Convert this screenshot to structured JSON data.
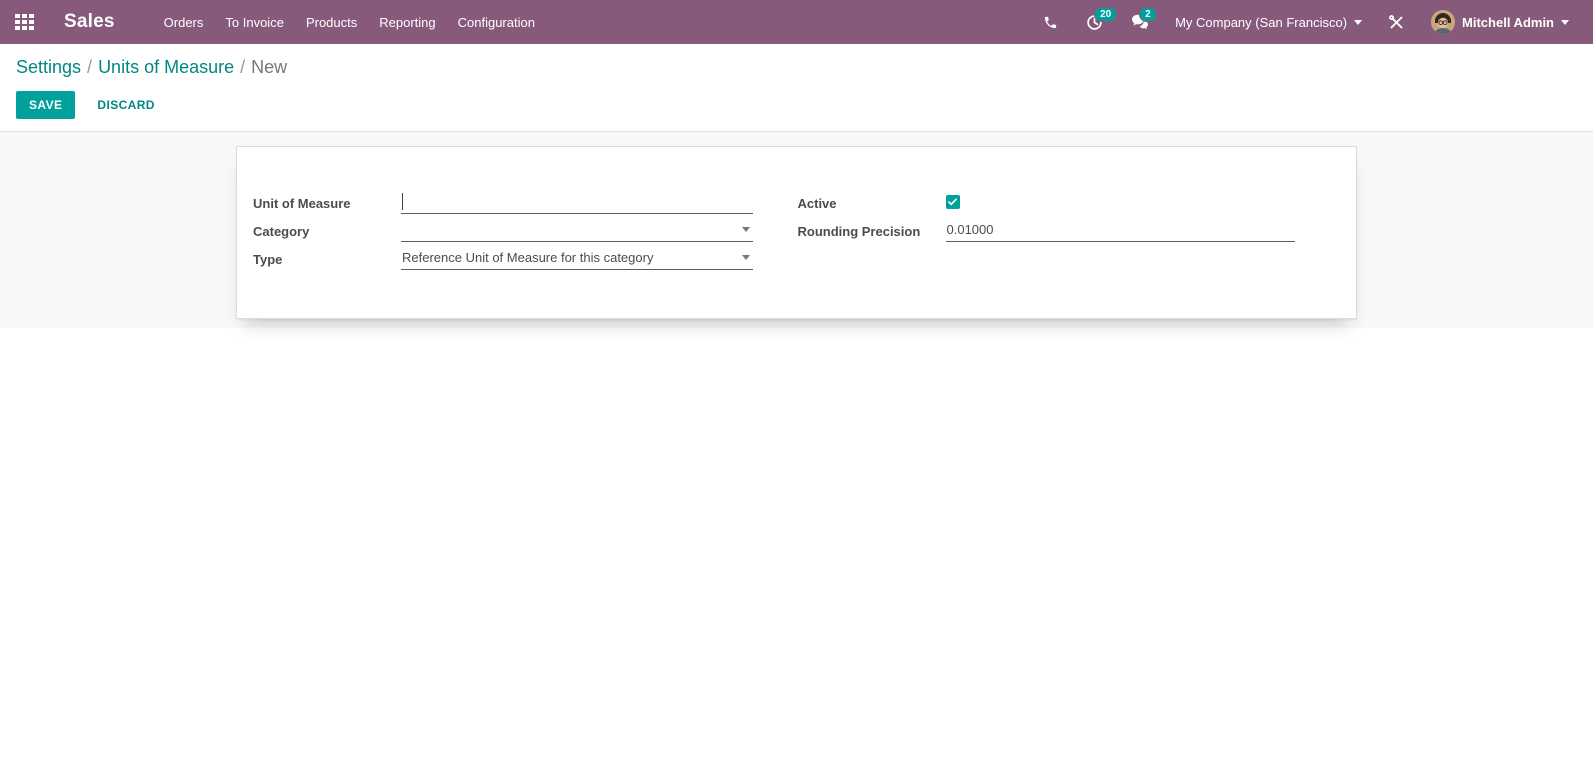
{
  "navbar": {
    "brand": "Sales",
    "menu": [
      {
        "label": "Orders"
      },
      {
        "label": "To Invoice"
      },
      {
        "label": "Products"
      },
      {
        "label": "Reporting"
      },
      {
        "label": "Configuration"
      }
    ],
    "activities_count": "20",
    "messages_count": "2",
    "company": "My Company (San Francisco)",
    "user": "Mitchell Admin",
    "icons": {
      "apps": "apps-grid-icon",
      "phone": "phone-icon",
      "activities": "clock-icon",
      "messages": "chat-bubbles-icon",
      "debug": "tools-icon"
    }
  },
  "breadcrumb": {
    "separator": "/",
    "items": [
      {
        "label": "Settings"
      },
      {
        "label": "Units of Measure"
      },
      {
        "label": "New"
      }
    ]
  },
  "actions": {
    "save": "SAVE",
    "discard": "DISCARD"
  },
  "form": {
    "unit_of_measure": {
      "label": "Unit of Measure",
      "value": ""
    },
    "category": {
      "label": "Category",
      "value": ""
    },
    "type": {
      "label": "Type",
      "value": "Reference Unit of Measure for this category"
    },
    "active": {
      "label": "Active",
      "checked": true
    },
    "rounding_precision": {
      "label": "Rounding Precision",
      "value": "0.01000"
    }
  },
  "colors": {
    "navbar": "#875A7B",
    "accent": "#00A09D",
    "link": "#008784"
  }
}
